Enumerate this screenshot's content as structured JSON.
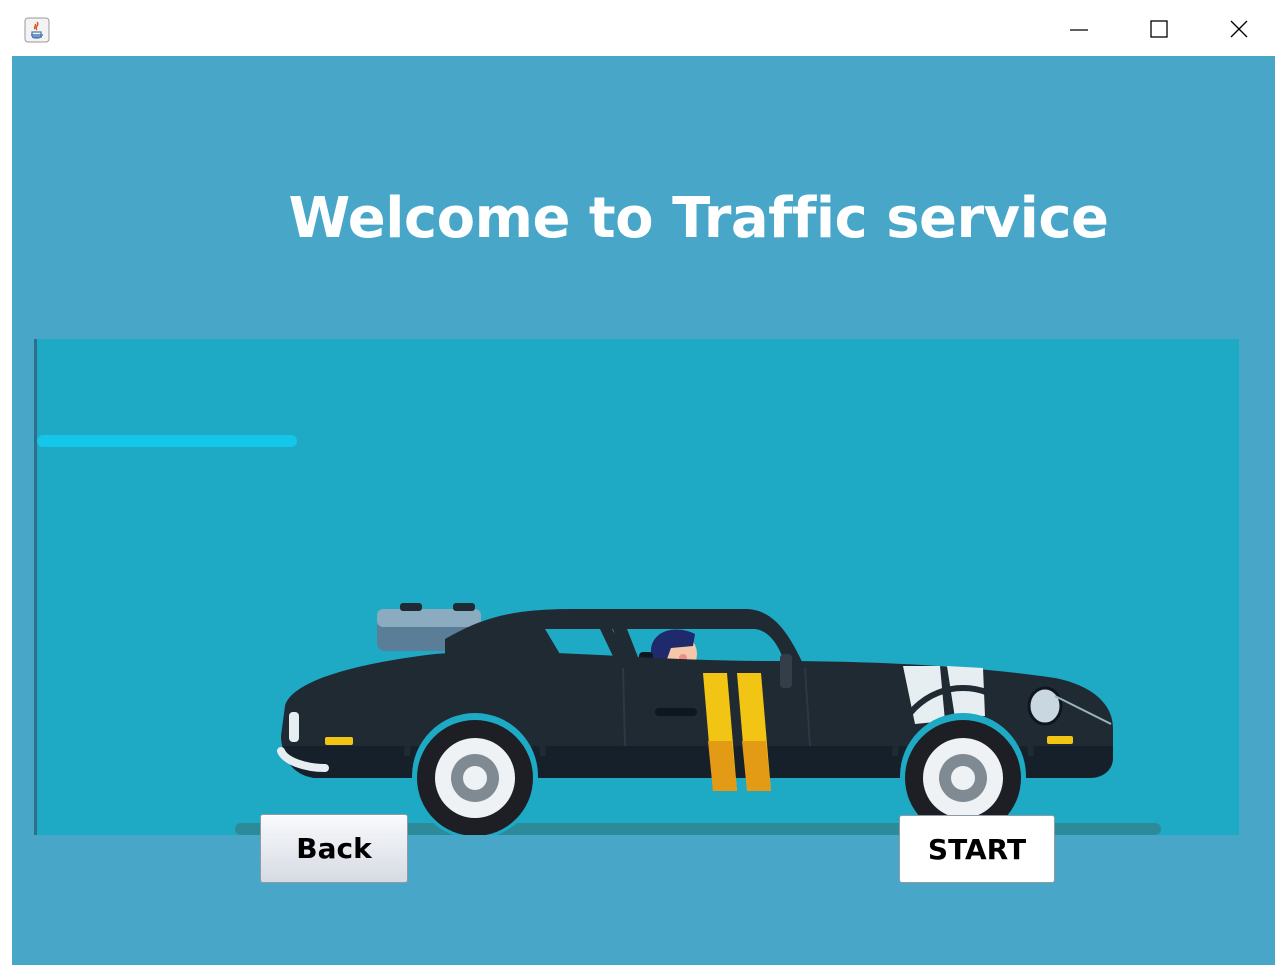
{
  "window": {
    "controls": {
      "minimize_icon": "minimize-icon",
      "maximize_icon": "maximize-icon",
      "close_icon": "close-icon"
    },
    "app_icon": "java-app-icon"
  },
  "colors": {
    "background": "#48a7c8",
    "scene": "#1ea9c4",
    "car_body": "#1f2a33",
    "stripe_yellow": "#f2c515",
    "stripe_orange": "#e39b16",
    "stripe_white": "#e6eef2",
    "speed_line": "#14c7e8"
  },
  "main": {
    "title": "Welcome to Traffic service",
    "illustration": "car-illustration"
  },
  "buttons": {
    "back_label": "Back",
    "start_label": "START"
  }
}
